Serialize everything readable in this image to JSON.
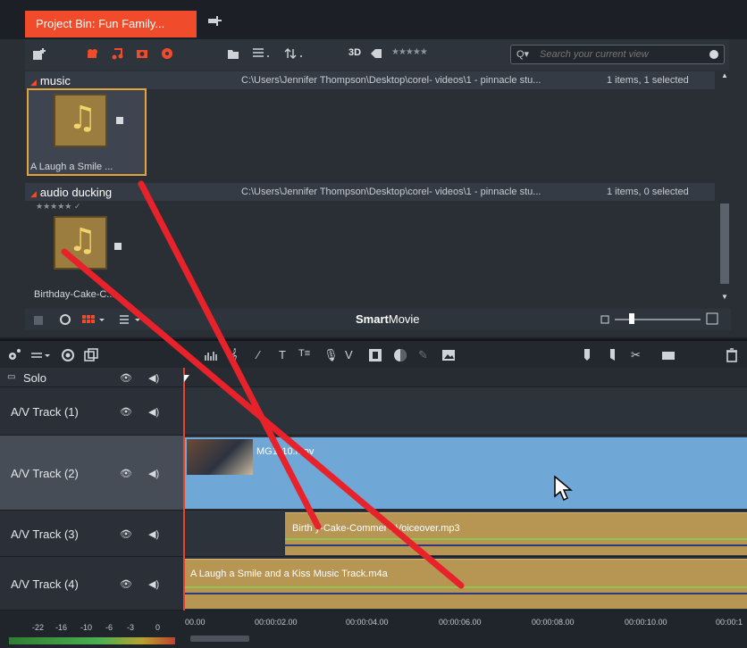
{
  "bin": {
    "tab_title": "Project Bin: Fun Family...",
    "toolbar": {
      "three_d": "3D",
      "stars": "★★★★★",
      "search_prefix": "Q▾",
      "search_placeholder": "Search your current view"
    },
    "groups": [
      {
        "name": "music",
        "path": "C:\\Users\\Jennifer Thompson\\Desktop\\corel- videos\\1 - pinnacle stu...",
        "count": "1 items, 1 selected",
        "item_caption": "A Laugh a Smile ...",
        "selected": true
      },
      {
        "name": "audio ducking",
        "path": "C:\\Users\\Jennifer Thompson\\Desktop\\corel- videos\\1 - pinnacle stu...",
        "count": "1 items, 0 selected",
        "item_caption": "Birthday-Cake-C...",
        "item_rating": "★★★★★ ✓",
        "selected": false
      }
    ],
    "footer": {
      "smartmovie_bold": "Smart",
      "smartmovie_rest": "Movie"
    }
  },
  "timeline": {
    "toolbar_text": {
      "title_tool": "T",
      "title_tool2": "T≡",
      "v_tool": "V"
    },
    "tracks": [
      {
        "label": "Solo",
        "eye": "👁",
        "speaker": "◀)"
      },
      {
        "label": "A/V Track (1)",
        "eye": "👁",
        "speaker": "◀)"
      },
      {
        "label": "A/V Track (2)",
        "eye": "👁",
        "speaker": "◀)"
      },
      {
        "label": "A/V Track (3)",
        "eye": "👁",
        "speaker": "◀)"
      },
      {
        "label": "A/V Track (4)",
        "eye": "👁",
        "speaker": "◀)"
      }
    ],
    "clips": {
      "video": "MG1110.mov",
      "audio_voiceover": "Birth   y-Cake-Commer   l-Voiceover.mp3",
      "audio_music": "A Laugh a Smile and a Kiss Music Track.m4a"
    },
    "ruler_labels": [
      "00.00",
      "00:00:02.00",
      "00:00:04.00",
      "00:00:06.00",
      "00:00:08.00",
      "00:00:10.00",
      "00:00:1"
    ],
    "meter_labels": [
      "-22",
      "-16",
      "-10",
      "-6",
      "-3",
      "0"
    ]
  },
  "colors": {
    "accent": "#f04b2a",
    "audio_clip": "#b79553",
    "video_clip": "#6fa7d7",
    "annotation_line": "#e8222a"
  }
}
